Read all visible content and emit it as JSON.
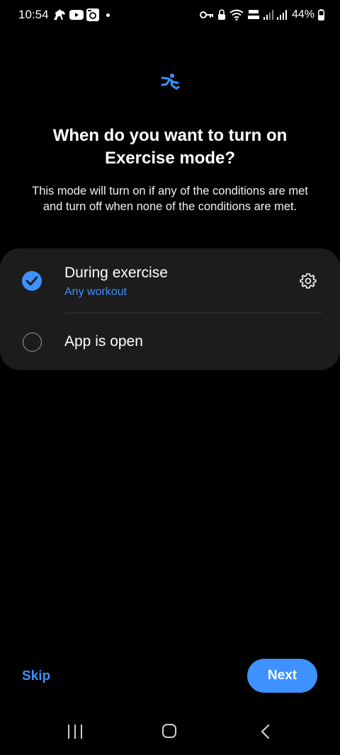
{
  "status_bar": {
    "time": "10:54",
    "battery": "44%",
    "left_icons": [
      "horse-icon",
      "youtube-icon",
      "camera-app-icon",
      "notification-dot"
    ],
    "right_icons": [
      "vpn-key-icon",
      "lock-icon",
      "wifi-icon",
      "volte-icon",
      "signal-icon",
      "signal-icon-2",
      "battery-icon"
    ]
  },
  "header": {
    "icon": "exercise-running-icon",
    "title": "When do you want to turn on Exercise mode?",
    "subtitle": "This mode will turn on if any of the conditions are met and turn off when none of the conditions are met."
  },
  "options": [
    {
      "title": "During exercise",
      "subtitle": "Any workout",
      "checked": true,
      "has_settings": true
    },
    {
      "title": "App is open",
      "checked": false,
      "has_settings": false
    }
  ],
  "footer": {
    "skip_label": "Skip",
    "next_label": "Next"
  },
  "nav_bar": {
    "icons": [
      "recents-icon",
      "home-icon",
      "back-icon"
    ]
  },
  "colors": {
    "accent": "#3e91ff",
    "background": "#000000",
    "card": "#1c1c1c"
  }
}
